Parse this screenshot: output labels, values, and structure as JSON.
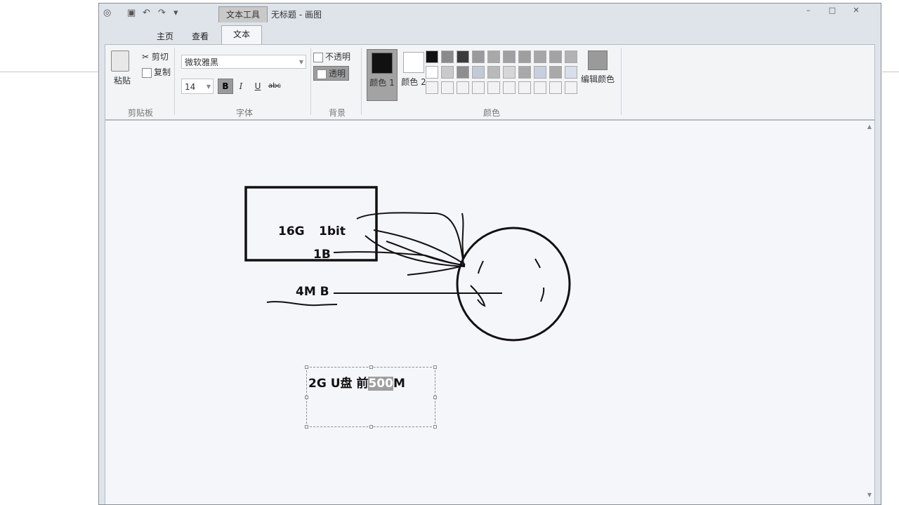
{
  "window": {
    "context_tab": "文本工具",
    "title": "无标题 - 画图",
    "controls": [
      "–",
      "□",
      "✕"
    ]
  },
  "tabs": [
    {
      "label": "主页"
    },
    {
      "label": "查看"
    },
    {
      "label": "文本"
    }
  ],
  "ribbon": {
    "clipboard": {
      "paste": "粘贴",
      "cut": "剪切",
      "copy": "复制",
      "label": "剪贴板"
    },
    "font": {
      "family": "微软雅黑",
      "size": "14",
      "bold": "B",
      "italic": "I",
      "underline": "U",
      "strike": "abc",
      "label": "字体"
    },
    "background": {
      "opaque": "不透明",
      "transparent": "透明",
      "label": "背景"
    },
    "colors": {
      "color1_label": "颜色 1",
      "color2_label": "颜色 2",
      "edit_label": "编辑颜色",
      "label": "颜色",
      "color1": "#111111",
      "color2": "#ffffff",
      "palette": [
        "#111111",
        "#8a8a8a",
        "#3a3a3a",
        "#9a9a9a",
        "#a8a8a8",
        "#a0a0a0",
        "#9e9e9e",
        "#a6a6a6",
        "#a2a2a2",
        "#b2b2b2",
        "#ffffff",
        "#c9c9c9",
        "#8e8e8e",
        "#c3cad6",
        "#b9b9b9",
        "#d6d6d6",
        "#a8a8a8",
        "#c8d0e0",
        "#a9a9a9",
        "#d8dfeb",
        "#f2f2f2",
        "#f2f2f2",
        "#f2f2f2",
        "#f2f2f2",
        "#f2f2f2",
        "#f2f2f2",
        "#f2f2f2",
        "#f2f2f2",
        "#f2f2f2",
        "#f2f2f2"
      ]
    }
  },
  "canvas": {
    "labels": {
      "t16g": "16G",
      "t1bit": "1bit",
      "t1b": "1B",
      "t4mb": "4M B"
    },
    "textbox": {
      "before": "2G U盘  前",
      "selected": "500",
      "after": "M"
    }
  }
}
